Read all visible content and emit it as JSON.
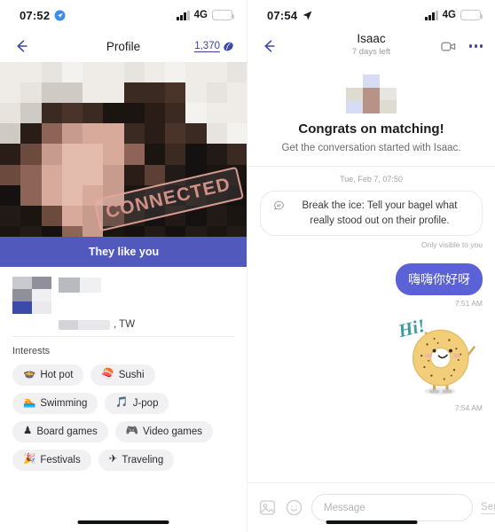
{
  "left": {
    "status": {
      "time": "07:52",
      "network": "4G",
      "location_icon": "location-arrow-icon",
      "battery_icon": "battery-low-power-icon"
    },
    "nav": {
      "back_icon": "back-arrow-icon",
      "title": "Profile",
      "beans_count": "1,370",
      "bean_icon": "coffee-bean-icon"
    },
    "photo": {
      "stamp_label": "CONNECTED",
      "banner_label": "They like you"
    },
    "identity": {
      "name": "",
      "location": ", TW"
    },
    "interests": {
      "title": "Interests",
      "chips": [
        {
          "emoji": "🍲",
          "label": "Hot pot",
          "icon": "hotpot-icon"
        },
        {
          "emoji": "🍣",
          "label": "Sushi",
          "icon": "sushi-icon"
        },
        {
          "emoji": "🏊",
          "label": "Swimming",
          "icon": "swimming-icon"
        },
        {
          "emoji": "🎵",
          "label": "J-pop",
          "icon": "music-note-icon"
        },
        {
          "emoji": "♟",
          "label": "Board games",
          "icon": "chess-pawn-icon"
        },
        {
          "emoji": "🎮",
          "label": "Video games",
          "icon": "gamepad-icon"
        },
        {
          "emoji": "🎉",
          "label": "Festivals",
          "icon": "confetti-icon"
        },
        {
          "emoji": "✈",
          "label": "Traveling",
          "icon": "airplane-icon"
        }
      ]
    }
  },
  "right": {
    "status": {
      "time": "07:54",
      "network": "4G",
      "location_icon": "location-arrow-icon",
      "battery_icon": "battery-low-power-icon"
    },
    "nav": {
      "back_icon": "back-arrow-icon",
      "title": "Isaac",
      "subtitle": "7 days left",
      "video_icon": "video-camera-icon",
      "more_icon": "more-options-icon"
    },
    "match": {
      "heading": "Congrats on matching!",
      "subheading": "Get the conversation started with Isaac.",
      "avatar_icon": "pixelated-avatar"
    },
    "timestamp": "Tue, Feb 7, 07:50",
    "icebreaker": {
      "icon": "speech-bubble-icon",
      "text": "Break the ice: Tell your bagel what really stood out on their profile.",
      "note": "Only visible to you"
    },
    "messages": [
      {
        "type": "text",
        "text": "嗨嗨你好呀",
        "time": "7:51 AM",
        "outgoing": true
      },
      {
        "type": "sticker",
        "sticker_label": "Hi!",
        "sticker_icon": "bagel-waving-sticker",
        "time": "7:54 AM",
        "outgoing": true
      }
    ],
    "composer": {
      "image_icon": "image-picker-icon",
      "emoji_icon": "emoji-picker-icon",
      "placeholder": "Message",
      "input_value": "",
      "send_label": "Send"
    }
  },
  "colors": {
    "accent_blue": "#3d4aa8",
    "bubble": "#5b61d6",
    "banner": "#5159bd",
    "stamp": "#e09a91",
    "battery": "#f5cb32",
    "sticker_text": "#3a9d9b"
  }
}
